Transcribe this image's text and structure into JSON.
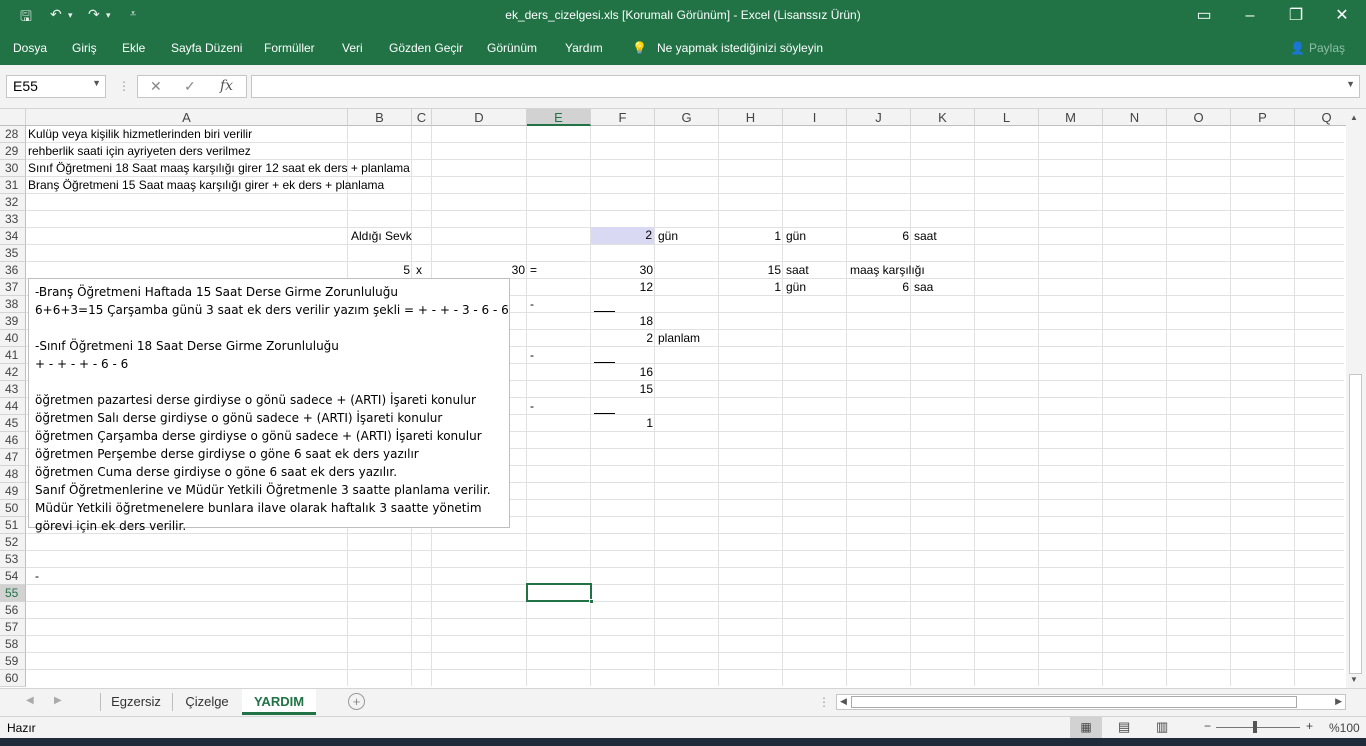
{
  "window": {
    "title": "ek_ders_cizelgesi.xls  [Korumalı Görünüm]  -  Excel (Lisanssız Ürün)",
    "share_label": "Paylaş"
  },
  "menu": {
    "items": [
      "Dosya",
      "Giriş",
      "Ekle",
      "Sayfa Düzeni",
      "Formüller",
      "Veri",
      "Gözden Geçir",
      "Görünüm",
      "Yardım"
    ],
    "tellme": "Ne yapmak istediğinizi söyleyin"
  },
  "formula_bar": {
    "name_box": "E55",
    "fx": "fx",
    "formula": ""
  },
  "columns": [
    "A",
    "B",
    "C",
    "D",
    "E",
    "F",
    "G",
    "H",
    "I",
    "J",
    "K",
    "L",
    "M",
    "N",
    "O",
    "P",
    "Q"
  ],
  "selected_column": "E",
  "rows": [
    "28",
    "29",
    "30",
    "31",
    "32",
    "33",
    "34",
    "35",
    "36",
    "37",
    "38",
    "39",
    "40",
    "41",
    "42",
    "43",
    "44",
    "45",
    "46",
    "47",
    "48",
    "49",
    "50",
    "51",
    "52",
    "53",
    "54",
    "55",
    "56",
    "57",
    "58",
    "59",
    "60"
  ],
  "selected_row": "55",
  "cells": {
    "a28": "Kulüp veya kişilik hizmetlerinden biri verilir",
    "a29": "rehberlik saati için ayriyeten ders verilmez",
    "a30": "Sınıf Öğretmeni 18 Saat maaş karşılığı girer 12 saat ek ders + planlama",
    "a31": "Branş Öğretmeni 15 Saat maaş karşılığı girer + ek ders + planlama",
    "b34": "Aldığı Sevk",
    "f34": "2",
    "g34": "gün",
    "h34": "1",
    "i34": "gün",
    "j34": "6",
    "k34": "saat",
    "b36": "5",
    "c36": "x",
    "d36": "30",
    "e36": "=",
    "f36": "30",
    "h36": "15",
    "i36": "saat",
    "j36": "maaş karşılığı",
    "f37": "12",
    "h37": "1",
    "i37": "gün",
    "j37": "6",
    "k37": "saa",
    "e38": "-",
    "f39": "18",
    "f40": "2",
    "g40": "planlam",
    "e41": "-",
    "f42": "16",
    "f43": "15",
    "e44": "-",
    "f45": "1",
    "a54": "-"
  },
  "textbox": [
    "-Branş Öğretmeni Haftada 15 Saat Derse Girme Zorunluluğu",
    "6+6+3=15 Çarşamba günü 3 saat ek ders verilir yazım şekli = + - + - 3 - 6 - 6",
    "",
    "-Sınıf Öğretmeni 18 Saat Derse Girme Zorunluluğu",
    "+  - + -  +  - 6 - 6",
    "",
    "öğretmen pazartesi derse girdiyse o gönü sadece + (ARTI) İşareti konulur",
    "öğretmen Salı derse girdiyse o gönü sadece + (ARTI) İşareti konulur",
    "öğretmen Çarşamba derse girdiyse o gönü sadece + (ARTI) İşareti konulur",
    "öğretmen Perşembe derse girdiyse o göne 6 saat ek ders yazılır",
    "öğretmen Cuma derse girdiyse o göne 6 saat ek ders yazılır.",
    "Sanıf Öğretmenlerine ve Müdür Yetkili Öğretmenle  3 saatte planlama verilir.",
    "Müdür Yetkili öğretmenelere bunlara ilave olarak haftalık 3 saatte yönetim",
    "görevi için ek ders verilir."
  ],
  "sheets": [
    "Egzersiz",
    "Çizelge",
    "YARDIM"
  ],
  "active_sheet": "YARDIM",
  "status": {
    "ready": "Hazır",
    "zoom": "%100"
  },
  "colors": {
    "brand": "#217346",
    "highlight": "#d9d9f3"
  }
}
